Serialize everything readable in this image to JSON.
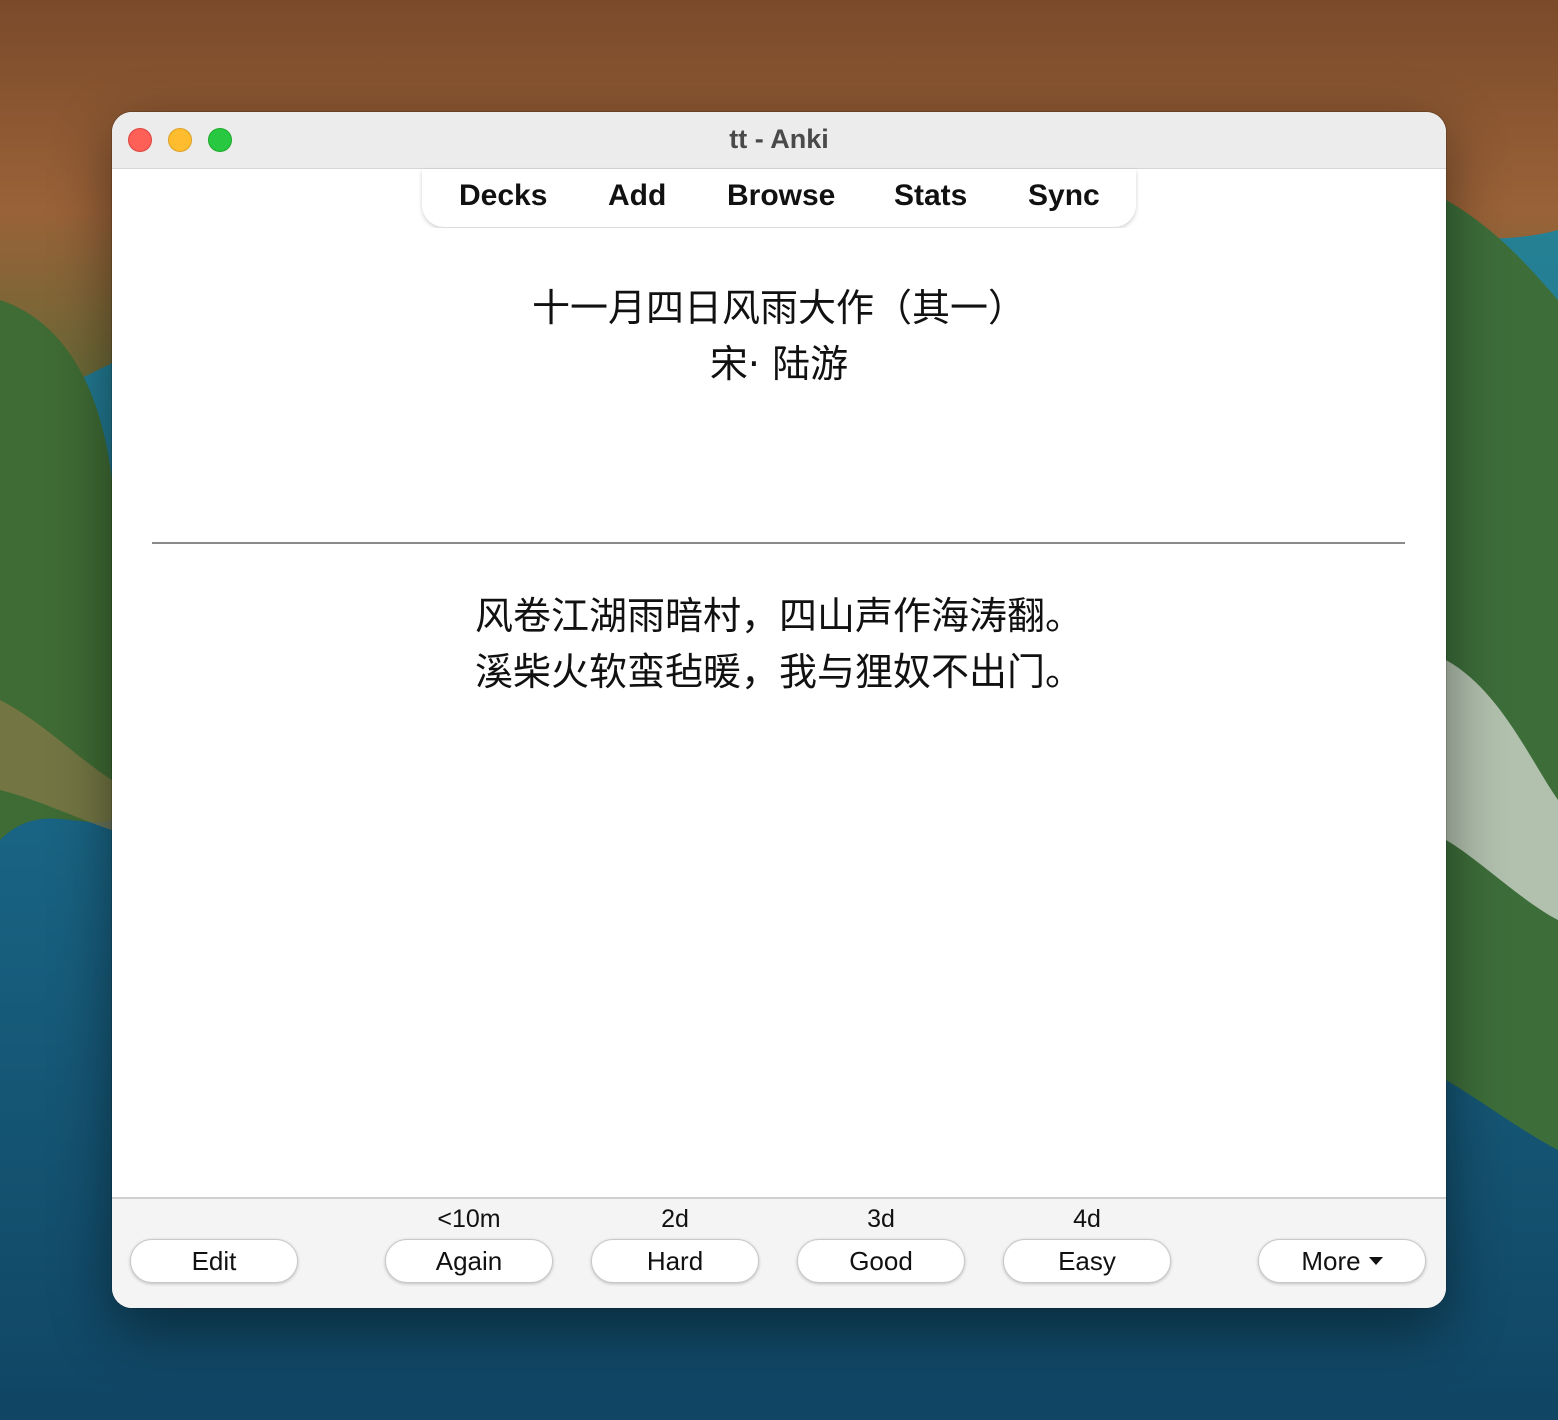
{
  "window": {
    "title": "tt - Anki"
  },
  "toolbar": {
    "items": [
      {
        "label": "Decks"
      },
      {
        "label": "Add"
      },
      {
        "label": "Browse"
      },
      {
        "label": "Stats"
      },
      {
        "label": "Sync"
      }
    ]
  },
  "card": {
    "front": {
      "title": "十一月四日风雨大作（其一）",
      "author": "宋· 陆游"
    },
    "back": {
      "line1": "风卷江湖雨暗村，四山声作海涛翻。",
      "line2": "溪柴火软蛮毡暖，我与狸奴不出门。"
    }
  },
  "answer_bar": {
    "edit_label": "Edit",
    "buttons": [
      {
        "interval": "<10m",
        "label": "Again"
      },
      {
        "interval": "2d",
        "label": "Hard"
      },
      {
        "interval": "3d",
        "label": "Good"
      },
      {
        "interval": "4d",
        "label": "Easy"
      }
    ],
    "more_label": "More"
  },
  "colors": {
    "close": "#fe5f57",
    "minimize": "#febc2e",
    "maximize": "#28c840"
  }
}
